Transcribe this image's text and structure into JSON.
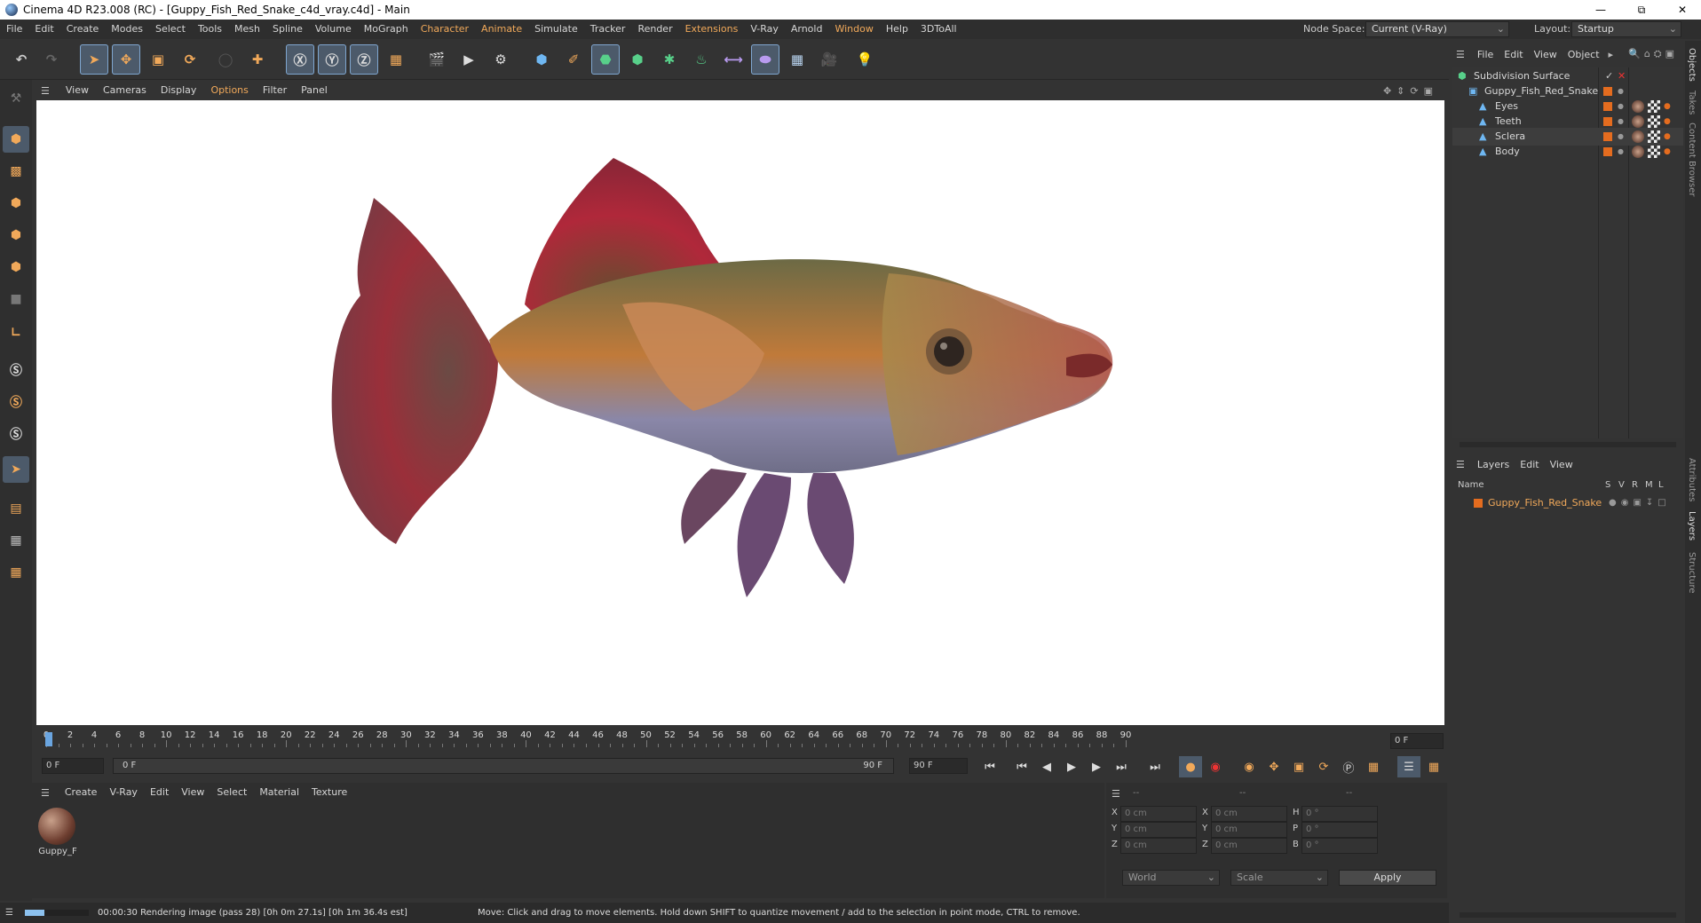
{
  "window": {
    "title": "Cinema 4D R23.008 (RC) - [Guppy_Fish_Red_Snake_c4d_vray.c4d] - Main"
  },
  "menu": [
    "File",
    "Edit",
    "Create",
    "Modes",
    "Select",
    "Tools",
    "Mesh",
    "Spline",
    "Volume",
    "MoGraph",
    "Character",
    "Animate",
    "Simulate",
    "Tracker",
    "Render",
    "Extensions",
    "V-Ray",
    "Arnold",
    "Window",
    "Help",
    "3DToAll"
  ],
  "node_space": {
    "label": "Node Space:",
    "value": "Current (V-Ray)"
  },
  "layout": {
    "label": "Layout:",
    "value": "Startup"
  },
  "viewport_menu": [
    "View",
    "Cameras",
    "Display",
    "Options",
    "Filter",
    "Panel"
  ],
  "timeline": {
    "ticks": [
      "0",
      "2",
      "4",
      "6",
      "8",
      "10",
      "12",
      "14",
      "16",
      "18",
      "20",
      "22",
      "24",
      "26",
      "28",
      "30",
      "32",
      "34",
      "36",
      "38",
      "40",
      "42",
      "44",
      "46",
      "48",
      "50",
      "52",
      "54",
      "56",
      "58",
      "60",
      "62",
      "64",
      "66",
      "68",
      "70",
      "72",
      "74",
      "76",
      "78",
      "80",
      "82",
      "84",
      "86",
      "88",
      "90"
    ],
    "current_frame": "0 F",
    "start": "0 F",
    "range_start": "0 F",
    "range_end": "90 F",
    "end": "90 F"
  },
  "material_menu": [
    "Create",
    "V-Ray",
    "Edit",
    "View",
    "Select",
    "Material",
    "Texture"
  ],
  "material": {
    "name": "Guppy_F"
  },
  "coords": {
    "header": [
      "--",
      "--",
      "--"
    ],
    "rows": [
      {
        "a": "X",
        "av": "0 cm",
        "b": "X",
        "bv": "0 cm",
        "c": "H",
        "cv": "0 °"
      },
      {
        "a": "Y",
        "av": "0 cm",
        "b": "Y",
        "bv": "0 cm",
        "c": "P",
        "cv": "0 °"
      },
      {
        "a": "Z",
        "av": "0 cm",
        "b": "Z",
        "bv": "0 cm",
        "c": "B",
        "cv": "0 °"
      }
    ],
    "world": "World",
    "scale": "Scale",
    "apply": "Apply"
  },
  "object_menu": [
    "File",
    "Edit",
    "View",
    "Object"
  ],
  "objects": [
    {
      "name": "Subdivision Surface",
      "indent": 0
    },
    {
      "name": "Guppy_Fish_Red_Snake",
      "indent": 1
    },
    {
      "name": "Eyes",
      "indent": 2
    },
    {
      "name": "Teeth",
      "indent": 2
    },
    {
      "name": "Sclera",
      "indent": 2
    },
    {
      "name": "Body",
      "indent": 2
    }
  ],
  "layer_menu": [
    "Layers",
    "Edit",
    "View"
  ],
  "layers_header": {
    "name": "Name",
    "cols": [
      "S",
      "V",
      "R",
      "M",
      "L"
    ]
  },
  "layers": [
    {
      "name": "Guppy_Fish_Red_Snake"
    }
  ],
  "side_tabs": [
    "Objects",
    "Takes",
    "Content Browser",
    "Attributes",
    "Layers",
    "Structure"
  ],
  "status": {
    "left": "00:00:30 Rendering image (pass 28) [0h  0m 27.1s] [0h  1m 36.4s est]",
    "right": "Move: Click and drag to move elements. Hold down SHIFT to quantize movement / add to the selection in point mode, CTRL to remove.",
    "progress": 0.3
  },
  "colors": {
    "accent": "#f1a95a",
    "layer_orange": "#e46c1f",
    "bg": "#333333"
  }
}
